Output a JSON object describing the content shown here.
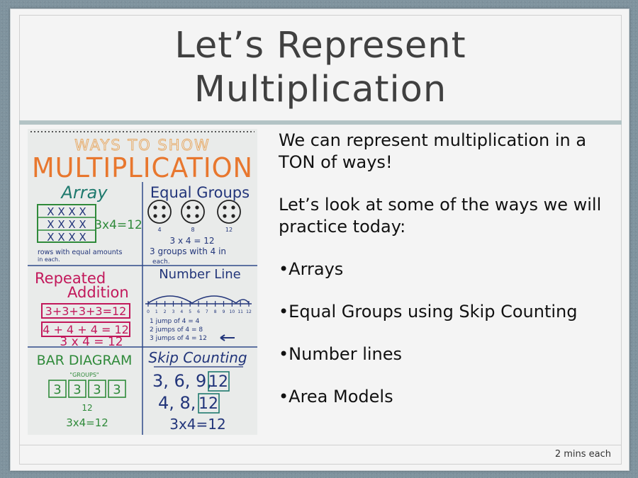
{
  "slide": {
    "title_line1": "Let’s Represent",
    "title_line2": "Multiplication",
    "intro": "We can represent multiplication in a TON of ways!",
    "lead": "Let’s look at some of the ways we will practice today:",
    "bullets": [
      "•Arrays",
      "•Equal Groups using Skip Counting",
      "•Number lines",
      "•Area Models"
    ],
    "footer": "2 mins each"
  },
  "poster": {
    "header_small": "WAYS TO SHOW",
    "header_big": "MULTIPLICATION",
    "array_title": "Array",
    "array_rows": [
      "X X X X",
      "X X X X",
      "X X X X"
    ],
    "array_equation": "3x4=12",
    "array_note_1": "rows with equal amounts",
    "array_note_2": "in each.",
    "groups_title": "Equal Groups",
    "groups_labels": [
      "4",
      "8",
      "12"
    ],
    "groups_equation": "3 x 4 = 12",
    "groups_note_1": "3 groups with 4 in",
    "groups_note_2": "each.",
    "repeated_title_1": "Repeated",
    "repeated_title_2": "Addition",
    "repeated_eq_1": "3+3+3+3=12",
    "repeated_eq_2": "4 + 4 + 4 = 12",
    "repeated_eq_3": "3 x 4 = 12",
    "numberline_title": "Number Line",
    "numberline_ticks": [
      "0",
      "1",
      "2",
      "3",
      "4",
      "5",
      "6",
      "7",
      "8",
      "9",
      "10",
      "11",
      "12"
    ],
    "numberline_note_1": "1 jump of 4 = 4",
    "numberline_note_2": "2 jumps of 4 = 8",
    "numberline_note_3": "3 jumps of 4 = 12",
    "bar_title": "BAR DIAGRAM",
    "bar_label": "\"GROUPS\"",
    "bar_cells": [
      "3",
      "3",
      "3",
      "3"
    ],
    "bar_total": "12",
    "bar_equation": "3x4=12",
    "skip_title": "Skip Counting",
    "skip_row_1": "3, 6, 9,",
    "skip_row_1_box": "12",
    "skip_row_2": "4, 8,",
    "skip_row_2_box": "12",
    "skip_equation": "3x4=12",
    "colors": {
      "orange": "#e8772e",
      "green": "#2f8a3a",
      "navy": "#22357a",
      "magenta": "#c2185b",
      "teal": "#1f7a6e"
    }
  }
}
